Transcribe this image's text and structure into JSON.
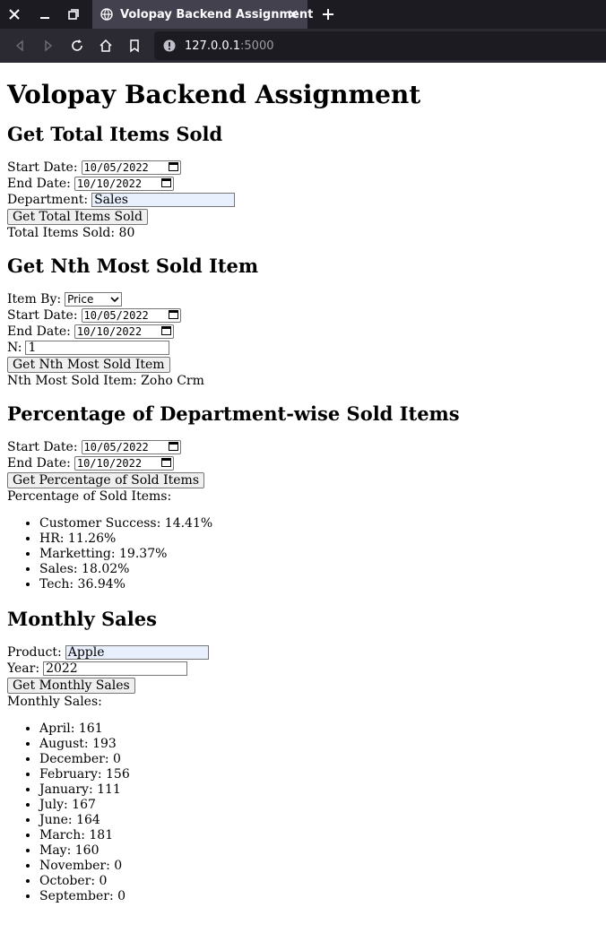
{
  "browser": {
    "tab_title": "Volopay Backend Assignment",
    "url_host": "127.0.0.1",
    "url_port": ":5000"
  },
  "page": {
    "title": "Volopay Backend Assignment",
    "total": {
      "heading": "Get Total Items Sold",
      "start_label": "Start Date:",
      "start_value": "10/05/2022",
      "end_label": "End Date:",
      "end_value": "10/10/2022",
      "dept_label": "Department:",
      "dept_value": "Sales",
      "button": "Get Total Items Sold",
      "result": "Total Items Sold: 80"
    },
    "nth": {
      "heading": "Get Nth Most Sold Item",
      "item_by_label": "Item By:",
      "item_by_value": "Price",
      "start_label": "Start Date:",
      "start_value": "10/05/2022",
      "end_label": "End Date:",
      "end_value": "10/10/2022",
      "n_label": "N:",
      "n_value": "1",
      "button": "Get Nth Most Sold Item",
      "result": "Nth Most Sold Item: Zoho Crm"
    },
    "pct": {
      "heading": "Percentage of Department-wise Sold Items",
      "start_label": "Start Date:",
      "start_value": "10/05/2022",
      "end_label": "End Date:",
      "end_value": "10/10/2022",
      "button": "Get Percentage of Sold Items",
      "result_label": "Percentage of Sold Items:",
      "items": [
        "Customer Success: 14.41%",
        "HR: 11.26%",
        "Marketting: 19.37%",
        "Sales: 18.02%",
        "Tech: 36.94%"
      ]
    },
    "monthly": {
      "heading": "Monthly Sales",
      "product_label": "Product:",
      "product_value": "Apple",
      "year_label": "Year:",
      "year_value": "2022",
      "button": "Get Monthly Sales",
      "result_label": "Monthly Sales:",
      "items": [
        "April: 161",
        "August: 193",
        "December: 0",
        "February: 156",
        "January: 111",
        "July: 167",
        "June: 164",
        "March: 181",
        "May: 160",
        "November: 0",
        "October: 0",
        "September: 0"
      ]
    }
  }
}
